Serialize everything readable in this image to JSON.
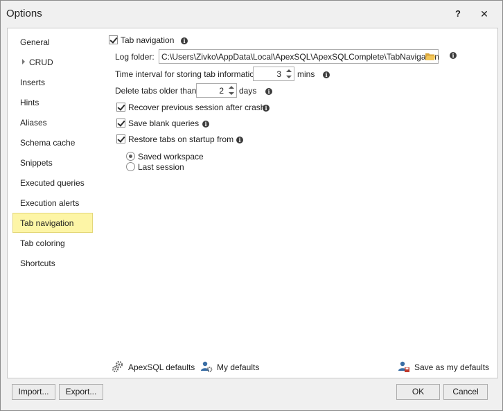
{
  "window": {
    "title": "Options",
    "help_glyph": "?",
    "close_glyph": "✕"
  },
  "nav": {
    "items": [
      {
        "label": "General",
        "selected": false
      },
      {
        "label": "CRUD",
        "selected": false,
        "expandable": true
      },
      {
        "label": "Inserts",
        "selected": false
      },
      {
        "label": "Hints",
        "selected": false
      },
      {
        "label": "Aliases",
        "selected": false
      },
      {
        "label": "Schema cache",
        "selected": false
      },
      {
        "label": "Snippets",
        "selected": false
      },
      {
        "label": "Executed queries",
        "selected": false
      },
      {
        "label": "Execution alerts",
        "selected": false
      },
      {
        "label": "Tab navigation",
        "selected": true
      },
      {
        "label": "Tab coloring",
        "selected": false
      },
      {
        "label": "Shortcuts",
        "selected": false
      }
    ]
  },
  "settings": {
    "tab_navigation": {
      "label": "Tab navigation",
      "checked": true
    },
    "log_folder": {
      "label": "Log folder:",
      "value": "C:\\Users\\Zivko\\AppData\\Local\\ApexSQL\\ApexSQLComplete\\TabNavigation"
    },
    "time_interval": {
      "label": "Time interval for storing tab information:",
      "value": "3",
      "unit": "mins"
    },
    "delete_tabs": {
      "label": "Delete tabs older than:",
      "value": "2",
      "unit": "days"
    },
    "recover_session": {
      "label": "Recover previous session after crash",
      "checked": true
    },
    "save_blank": {
      "label": "Save blank queries",
      "checked": true
    },
    "restore_tabs": {
      "label": "Restore tabs on startup from",
      "checked": true
    },
    "restore_options": [
      {
        "label": "Saved workspace",
        "selected": true
      },
      {
        "label": "Last session",
        "selected": false
      }
    ],
    "info_glyph": "i"
  },
  "defaults": {
    "apexsql_label": "ApexSQL defaults",
    "my_label": "My defaults",
    "save_label": "Save as my defaults"
  },
  "buttons": {
    "import": "Import...",
    "export": "Export...",
    "ok": "OK",
    "cancel": "Cancel"
  },
  "colors": {
    "selected_nav": "#fdf5a6",
    "folder_icon": "#e8b94a",
    "gear_icon": "#6d6d6d",
    "user_icon": "#3a6ea5"
  }
}
